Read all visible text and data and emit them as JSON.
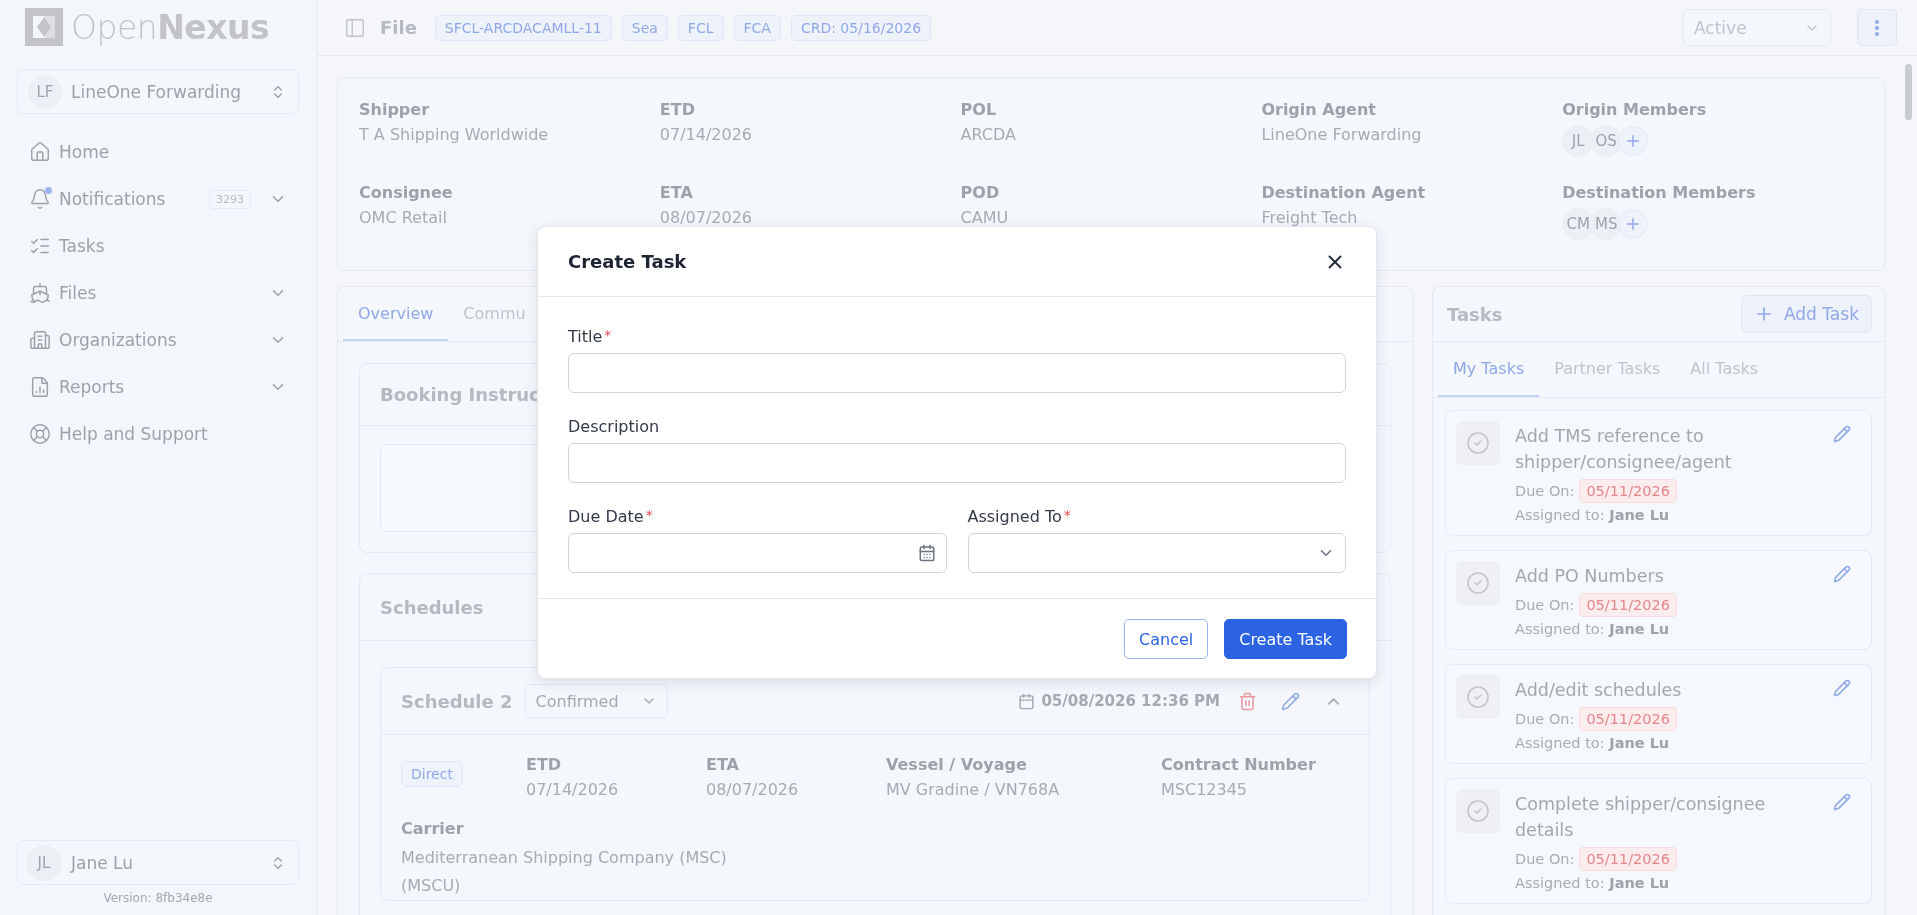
{
  "sidebar": {
    "logo": "Open**Nexus**",
    "org": {
      "initials": "LF",
      "name": "LineOne Forwarding"
    },
    "nav": [
      {
        "label": "Home",
        "expandable": false,
        "dot": false
      },
      {
        "label": "Notifications",
        "badge": "3293",
        "expandable": true,
        "dot": true
      },
      {
        "label": "Tasks",
        "expandable": false,
        "dot": false
      },
      {
        "label": "Files",
        "expandable": true,
        "dot": false
      },
      {
        "label": "Organizations",
        "expandable": true,
        "dot": false
      },
      {
        "label": "Reports",
        "expandable": true,
        "dot": false
      },
      {
        "label": "Help and Support",
        "expandable": false,
        "dot": false
      }
    ],
    "user": {
      "initials": "JL",
      "name": "Jane Lu"
    },
    "version": "Version: 8fb34e8e"
  },
  "header": {
    "title": "File",
    "tags": [
      "SFCL-ARCDACAMLL-11",
      "Sea",
      "FCL",
      "FCA",
      "CRD: 05/16/2026"
    ],
    "status": "Active"
  },
  "info": [
    {
      "kind": "text",
      "label": "Shipper",
      "value": "T A Shipping Worldwide"
    },
    {
      "kind": "text",
      "label": "ETD",
      "value": "07/14/2026"
    },
    {
      "kind": "text",
      "label": "POL",
      "value": "ARCDA"
    },
    {
      "kind": "text",
      "label": "Origin Agent",
      "value": "LineOne Forwarding"
    },
    {
      "kind": "members",
      "label": "Origin Members",
      "members": [
        "JL",
        "OS"
      ]
    },
    {
      "kind": "text",
      "label": "Consignee",
      "value": "OMC Retail"
    },
    {
      "kind": "text",
      "label": "ETA",
      "value": "08/07/2026"
    },
    {
      "kind": "text",
      "label": "POD",
      "value": "CAMU"
    },
    {
      "kind": "text",
      "label": "Destination Agent",
      "value": "Freight Tech"
    },
    {
      "kind": "members",
      "label": "Destination Members",
      "members": [
        "CM",
        "MS"
      ]
    }
  ],
  "overview": {
    "tabs": [
      {
        "label": "Overview",
        "selected": true
      },
      {
        "label": "Commu",
        "selected": false
      }
    ],
    "booking": {
      "title": "Booking Instruc"
    },
    "schedules": {
      "title": "Schedules",
      "schedule": {
        "name": "Schedule 2",
        "status": "Confirmed",
        "timestamp": "05/08/2026 12:36 PM",
        "route_tag": "Direct",
        "fields": [
          {
            "label": "ETD",
            "value": "07/14/2026"
          },
          {
            "label": "ETA",
            "value": "08/07/2026"
          },
          {
            "label": "Vessel / Voyage",
            "value": "MV Gradine / VN768A"
          },
          {
            "label": "Contract Number",
            "value": "MSC12345"
          }
        ],
        "carrier": {
          "label": "Carrier",
          "value": "Mediterranean Shipping Company (MSC) (MSCU)"
        }
      }
    }
  },
  "tasks": {
    "title": "Tasks",
    "add_button": "Add Task",
    "tabs": [
      {
        "label": "My Tasks",
        "selected": true
      },
      {
        "label": "Partner Tasks",
        "selected": false
      },
      {
        "label": "All Tasks",
        "selected": false
      }
    ],
    "items": [
      {
        "title": "Add TMS reference to shipper/consignee/agent",
        "due_label": "Due On:",
        "due": "05/11/2026",
        "assigned": "Assigned to: **Jane Lu**"
      },
      {
        "title": "Add PO Numbers",
        "due_label": "Due On:",
        "due": "05/11/2026",
        "assigned": "Assigned to: **Jane Lu**"
      },
      {
        "title": "Add/edit schedules",
        "due_label": "Due On:",
        "due": "05/11/2026",
        "assigned": "Assigned to: **Jane Lu**"
      },
      {
        "title": "Complete shipper/consignee details",
        "due_label": "Due On:",
        "due": "05/11/2026",
        "assigned": "Assigned to: **Jane Lu**"
      }
    ]
  },
  "modal": {
    "title": "Create Task",
    "required_mark": "*",
    "rows": [
      [
        {
          "label": "Title",
          "required": true,
          "kind": "text"
        }
      ],
      [
        {
          "label": "Description",
          "required": false,
          "kind": "text"
        }
      ],
      [
        {
          "label": "Due Date",
          "required": true,
          "kind": "date"
        },
        {
          "label": "Assigned To",
          "required": true,
          "kind": "select"
        }
      ]
    ],
    "buttons": [
      {
        "label": "Cancel",
        "kind": "secondary"
      },
      {
        "label": "Create Task",
        "kind": "primary"
      }
    ]
  }
}
